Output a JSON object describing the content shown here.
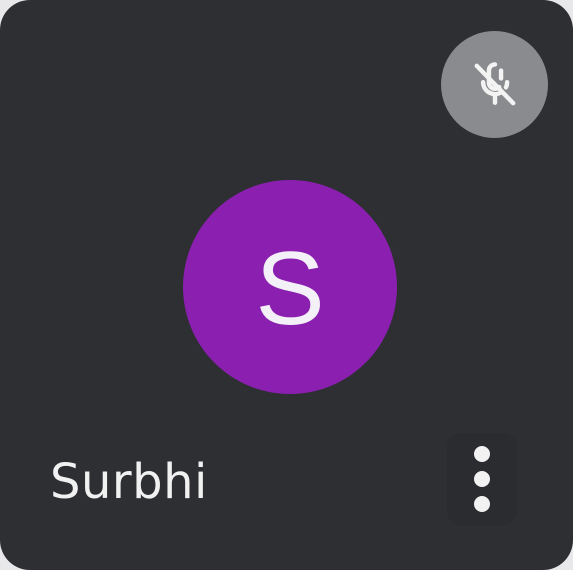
{
  "participant": {
    "name": "Surbhi",
    "initial": "S",
    "avatar_color": "#8a1fb0",
    "muted": true,
    "mute_icon": "mic-off-icon",
    "menu_icon": "more-vert-icon"
  },
  "colors": {
    "tile_background": "#2e2f33",
    "mute_badge": "#8a8b8e",
    "text": "#f1f1f2"
  }
}
